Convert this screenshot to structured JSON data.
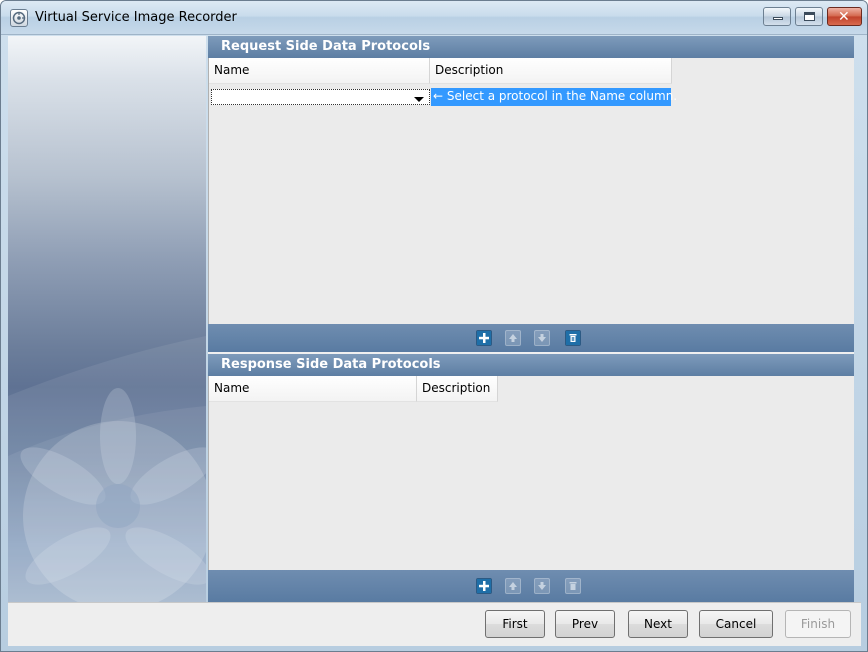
{
  "window": {
    "title": "Virtual Service Image Recorder",
    "icons": {
      "app": "recorder-app-icon",
      "minimize": "minimize-icon",
      "maximize": "maximize-icon",
      "close": "close-icon"
    }
  },
  "request_panel": {
    "title": "Request Side Data Protocols",
    "columns": [
      "Name",
      "Description"
    ],
    "row": {
      "name_value": "",
      "hint": "Select a protocol in the Name column."
    },
    "toolbar": [
      {
        "icon": "add-icon",
        "enabled": true
      },
      {
        "icon": "move-up-icon",
        "enabled": false
      },
      {
        "icon": "move-down-icon",
        "enabled": false
      },
      {
        "icon": "delete-icon",
        "enabled": true
      }
    ]
  },
  "response_panel": {
    "title": "Response Side Data Protocols",
    "columns": [
      "Name",
      "Description"
    ],
    "toolbar": [
      {
        "icon": "add-icon",
        "enabled": true
      },
      {
        "icon": "move-up-icon",
        "enabled": false
      },
      {
        "icon": "move-down-icon",
        "enabled": false
      },
      {
        "icon": "delete-icon",
        "enabled": false
      }
    ]
  },
  "buttons": {
    "first": "First",
    "prev": "Prev",
    "next": "Next",
    "cancel": "Cancel",
    "finish": "Finish"
  },
  "colors": {
    "panel_header": "#5d7ea3",
    "selection": "#3399ff",
    "toolbar": "#5f80a7"
  }
}
